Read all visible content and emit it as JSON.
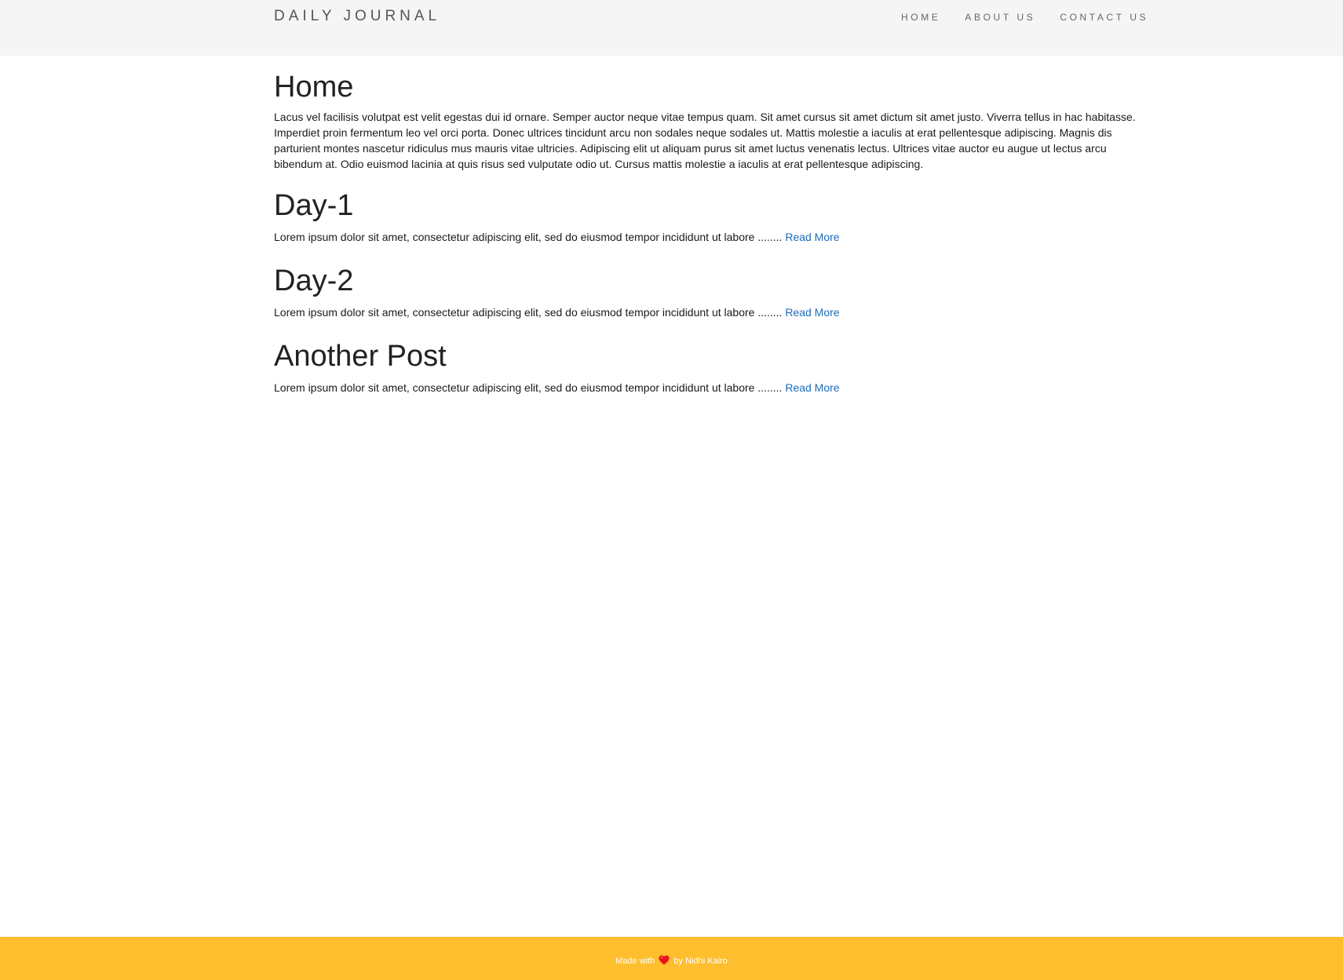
{
  "navbar": {
    "brand": "DAILY JOURNAL",
    "links": [
      "HOME",
      "ABOUT US",
      "CONTACT US"
    ]
  },
  "home": {
    "title": "Home",
    "text": "Lacus vel facilisis volutpat est velit egestas dui id ornare. Semper auctor neque vitae tempus quam. Sit amet cursus sit amet dictum sit amet justo. Viverra tellus in hac habitasse. Imperdiet proin fermentum leo vel orci porta. Donec ultrices tincidunt arcu non sodales neque sodales ut. Mattis molestie a iaculis at erat pellentesque adipiscing. Magnis dis parturient montes nascetur ridiculus mus mauris vitae ultricies. Adipiscing elit ut aliquam purus sit amet luctus venenatis lectus. Ultrices vitae auctor eu augue ut lectus arcu bibendum at. Odio euismod lacinia at quis risus sed vulputate odio ut. Cursus mattis molestie a iaculis at erat pellentesque adipiscing."
  },
  "posts": [
    {
      "title": "Day-1",
      "excerpt": "Lorem ipsum dolor sit amet, consectetur adipiscing elit, sed do eiusmod tempor incididunt ut labore ........",
      "link": "Read More"
    },
    {
      "title": "Day-2",
      "excerpt": "Lorem ipsum dolor sit amet, consectetur adipiscing elit, sed do eiusmod tempor incididunt ut labore ........",
      "link": "Read More"
    },
    {
      "title": "Another Post",
      "excerpt": "Lorem ipsum dolor sit amet, consectetur adipiscing elit, sed do eiusmod tempor incididunt ut labore ........",
      "link": "Read More"
    }
  ],
  "footer": {
    "prefix": "Made with",
    "icon": "heart-icon",
    "suffix": "by Nidhi Kairo"
  },
  "colors": {
    "navbar_bg": "#f5f5f5",
    "link": "#1e6bb8",
    "footer_bg": "#ffbe2e",
    "heart": "#e8141c"
  }
}
